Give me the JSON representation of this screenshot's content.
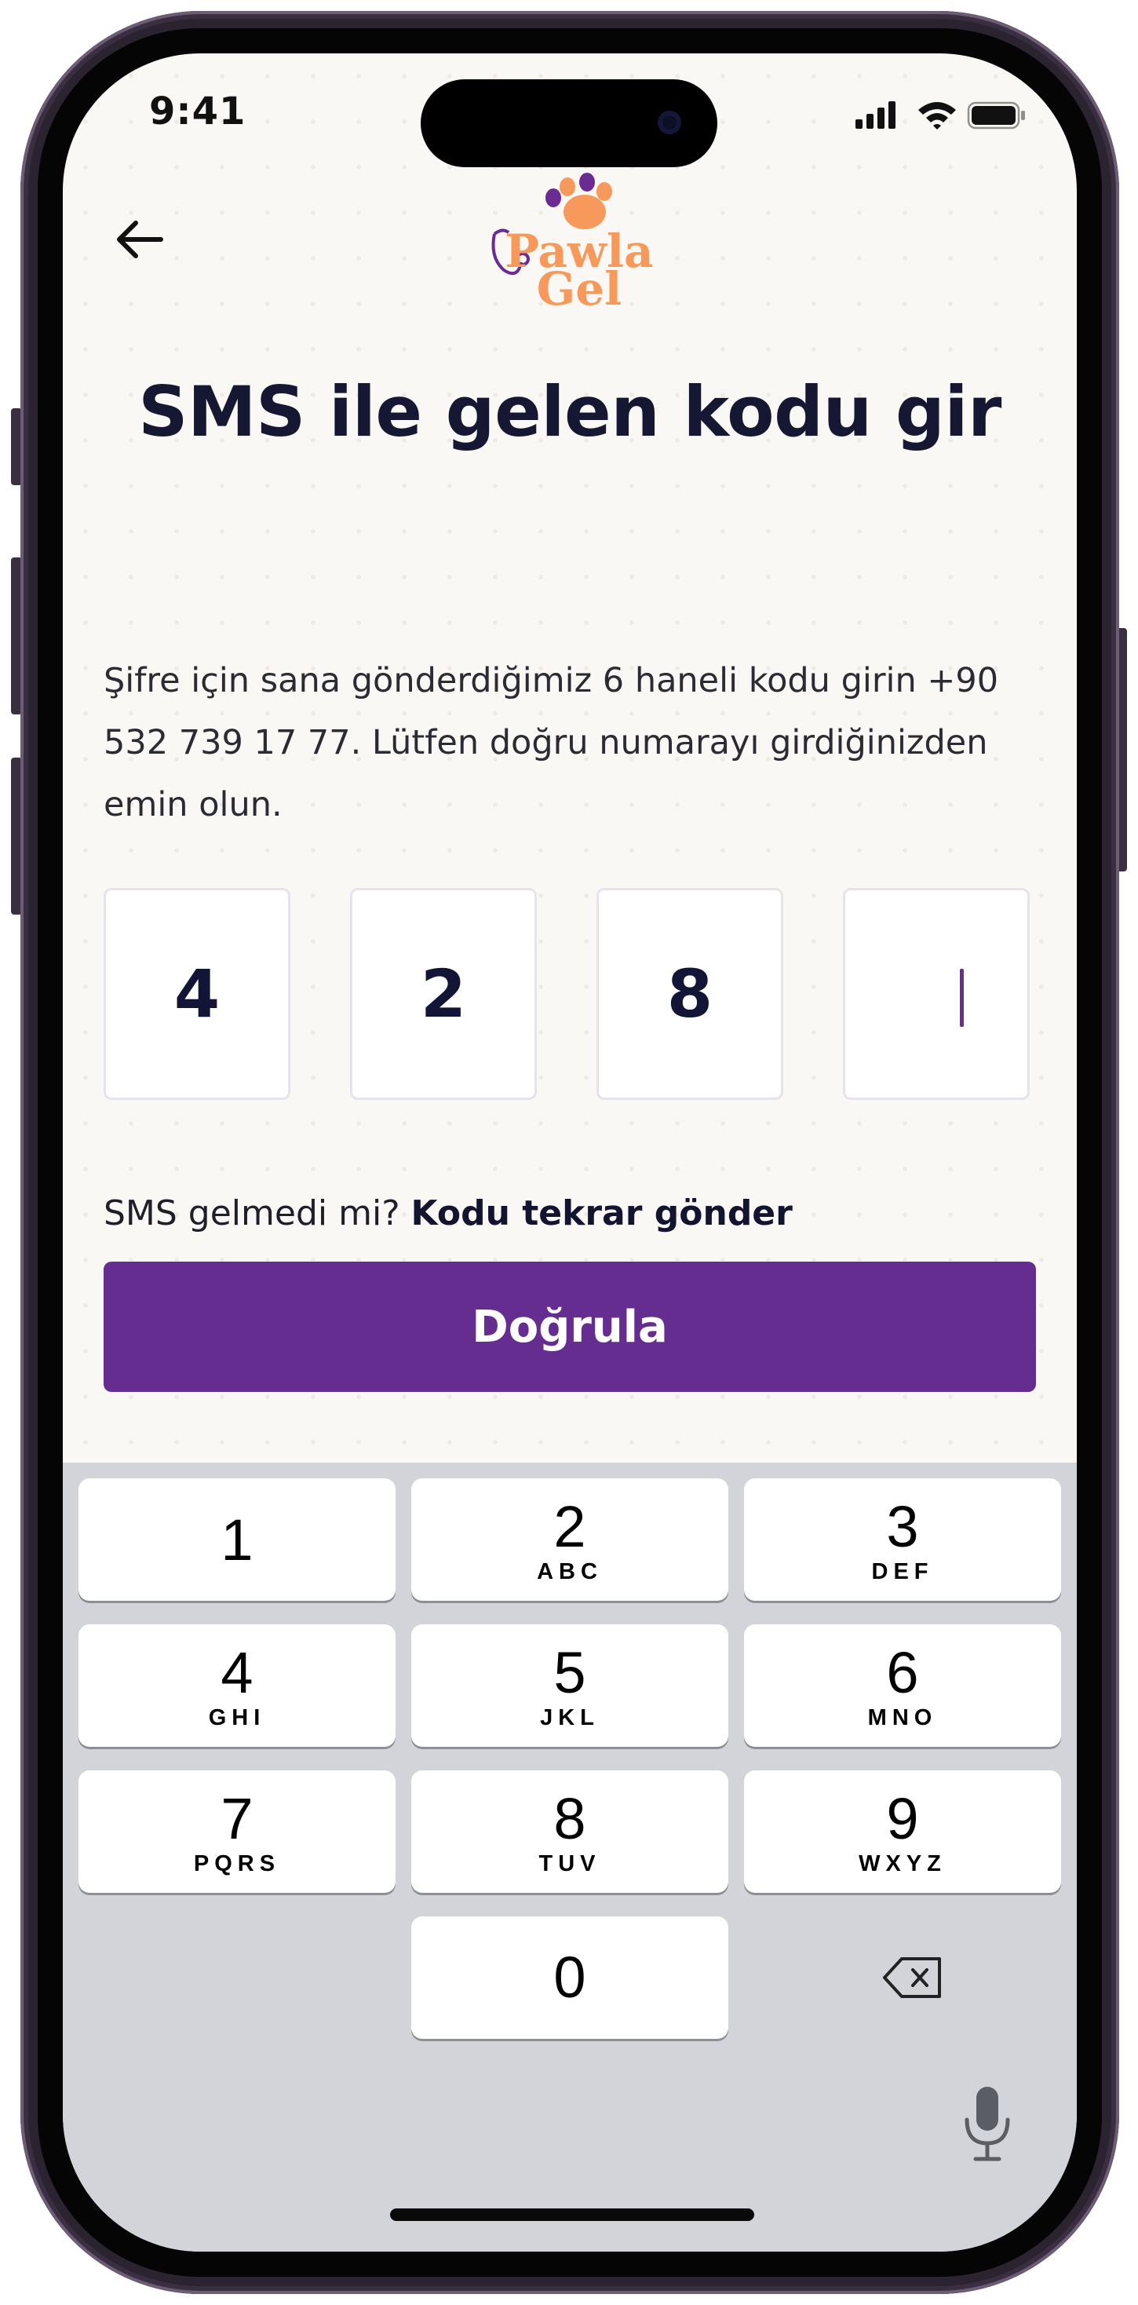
{
  "status_bar": {
    "time": "9:41"
  },
  "header": {
    "logo_text_top": "Pawla",
    "logo_text_bottom": "Gel",
    "title": "SMS ile gelen kodu gir"
  },
  "instructions": "Şifre için sana gönderdiğimiz 6 haneli kodu girin +90 532 739 17 77. Lütfen doğru numarayı girdiğinizden emin olun.",
  "code_inputs": [
    "4",
    "2",
    "8",
    ""
  ],
  "resend": {
    "prompt": "SMS gelmedi mi? ",
    "link": "Kodu tekrar gönder"
  },
  "verify_button": {
    "label": "Doğrula"
  },
  "keypad": {
    "keys": [
      {
        "digit": "1",
        "letters": ""
      },
      {
        "digit": "2",
        "letters": "ABC"
      },
      {
        "digit": "3",
        "letters": "DEF"
      },
      {
        "digit": "4",
        "letters": "GHI"
      },
      {
        "digit": "5",
        "letters": "JKL"
      },
      {
        "digit": "6",
        "letters": "MNO"
      },
      {
        "digit": "7",
        "letters": "PQRS"
      },
      {
        "digit": "8",
        "letters": "TUV"
      },
      {
        "digit": "9",
        "letters": "WXYZ"
      },
      {
        "digit": "0",
        "letters": ""
      }
    ]
  },
  "colors": {
    "primary": "#662d91",
    "logo_orange": "#f7995a",
    "logo_purple": "#6a2b92",
    "title": "#161833",
    "background": "#faf8f5",
    "keyboard_bg": "#d2d4da"
  }
}
